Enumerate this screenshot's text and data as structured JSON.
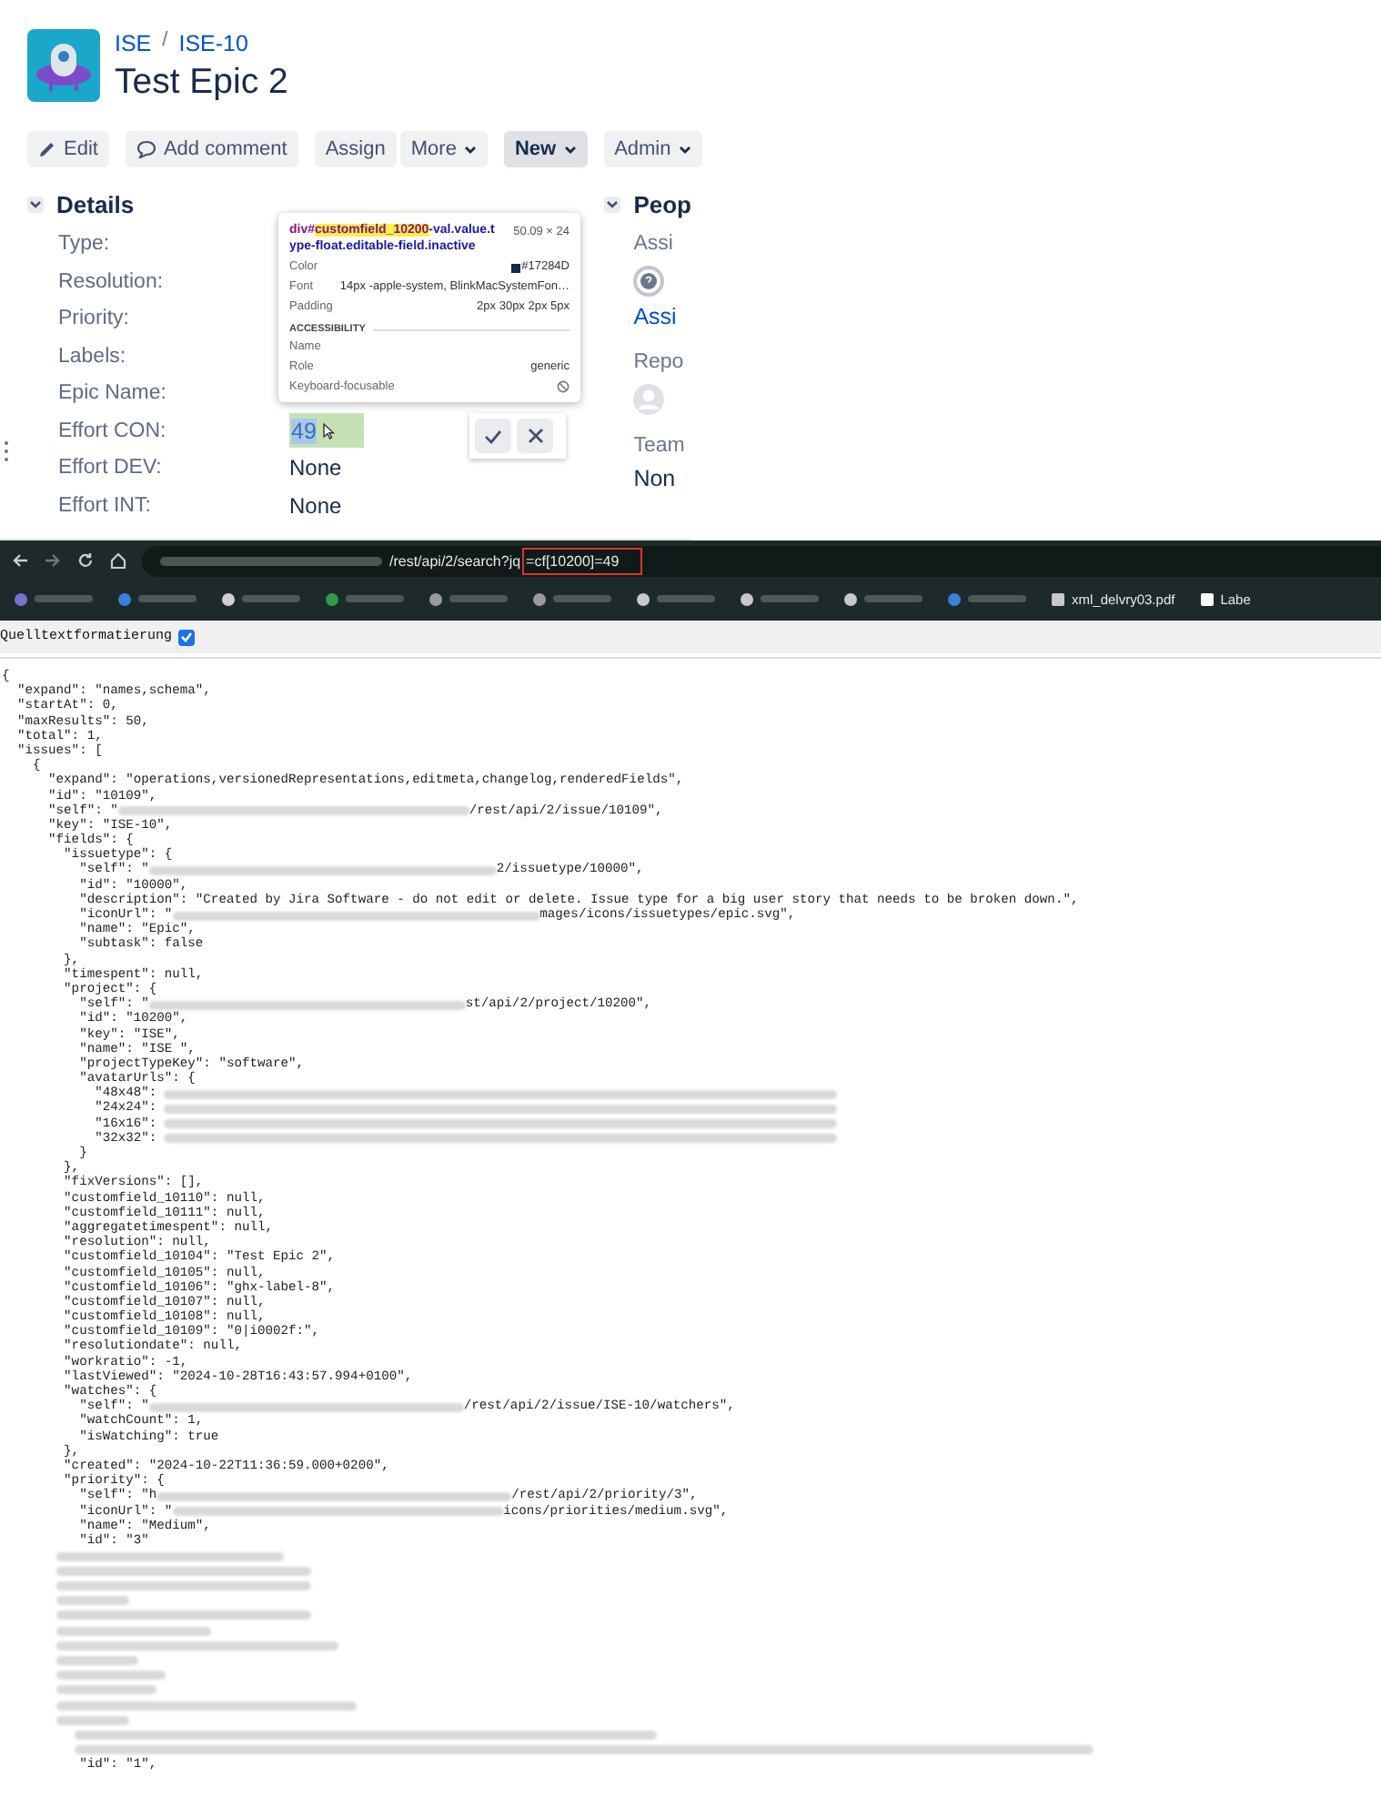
{
  "jira": {
    "breadcrumbs": [
      "ISE",
      "ISE-10"
    ],
    "breadcrumb_separator": "/",
    "title": "Test Epic 2",
    "toolbar": [
      [
        {
          "label": "Edit",
          "kind": "edit",
          "primary": false
        }
      ],
      [
        {
          "label": "Add comment",
          "kind": "comment",
          "primary": false
        }
      ],
      [
        {
          "label": "Assign",
          "kind": "plain",
          "primary": false
        },
        {
          "label": "More",
          "kind": "menu",
          "primary": false
        }
      ],
      [
        {
          "label": "New",
          "kind": "menu",
          "primary": true
        }
      ],
      [
        {
          "label": "Admin",
          "kind": "menu",
          "primary": false
        }
      ]
    ],
    "details": {
      "heading": "Details",
      "fields": [
        {
          "label": "Type:"
        },
        {
          "label": "Resolution:"
        },
        {
          "label": "Priority:"
        },
        {
          "label": "Labels:"
        },
        {
          "label": "Epic Name:"
        },
        {
          "label": "Effort CON:",
          "value": "49",
          "kind": "selected"
        },
        {
          "label": "Effort DEV:",
          "value": "None",
          "kind": "plain"
        },
        {
          "label": "Effort INT:",
          "value": "None",
          "kind": "plain"
        }
      ]
    },
    "people": {
      "heading": "Peop",
      "assignee_label": "Assi",
      "assign_link": "Assi",
      "reporter_label": "Repo",
      "team_label": "Team",
      "team_value": "Non"
    },
    "inspector": {
      "selector_tag": "div#",
      "selector_id": "customfield_10200",
      "selector_rest": "-val.value.type-float.editable-field.inactive",
      "size": "50.09 × 24",
      "rows": [
        {
          "label": "Color",
          "value": "#17284D",
          "color": "#17284d"
        },
        {
          "label": "Font",
          "value": "14px -apple-system, BlinkMacSystemFon…"
        },
        {
          "label": "Padding",
          "value": "2px 30px 2px 5px"
        }
      ],
      "section": "ACCESSIBILITY",
      "a11y_rows": [
        {
          "label": "Name",
          "kind": "text"
        },
        {
          "label": "Role",
          "kind": "text",
          "value": "generic"
        },
        {
          "label": "Keyboard-focusable",
          "kind": "blocked"
        }
      ]
    }
  },
  "browser": {
    "url_path": "/rest/api/2/search?jq",
    "url_highlight": "=cf[10200]=49",
    "bookmarks": [
      {
        "kind": "blurred",
        "color": "#7b6fd0"
      },
      {
        "kind": "blurred",
        "color": "#3b7fd9"
      },
      {
        "kind": "blurred",
        "color": "#d0d0d0"
      },
      {
        "kind": "blurred",
        "color": "#2e9a4a"
      },
      {
        "kind": "blurred",
        "color": "#9a9a9a"
      },
      {
        "kind": "blurred",
        "color": "#9a9a9a"
      },
      {
        "kind": "blurred",
        "color": "#c8c8c8"
      },
      {
        "kind": "blurred",
        "color": "#c8c8c8"
      },
      {
        "kind": "blurred",
        "color": "#c8c8c8"
      },
      {
        "kind": "blurred",
        "color": "#3b7fd9"
      },
      {
        "kind": "file",
        "color": "#c8c8c8",
        "label": "xml_delvry03.pdf"
      },
      {
        "kind": "file",
        "color": "#ffffff",
        "label": "Labe"
      }
    ]
  },
  "source_toggle": {
    "label": "Quelltextformatierung",
    "checked": true
  },
  "code_lines": [
    {
      "kind": "plain",
      "text": "{"
    },
    {
      "kind": "plain",
      "text": "  \"expand\": \"names,schema\","
    },
    {
      "kind": "plain",
      "text": "  \"startAt\": 0,"
    },
    {
      "kind": "plain",
      "text": "  \"maxResults\": 50,"
    },
    {
      "kind": "plain",
      "text": "  \"total\": 1,"
    },
    {
      "kind": "plain",
      "text": "  \"issues\": ["
    },
    {
      "kind": "plain",
      "text": "    {"
    },
    {
      "kind": "plain",
      "text": "      \"expand\": \"operations,versionedRepresentations,editmeta,changelog,renderedFields\","
    },
    {
      "kind": "plain",
      "text": "      \"id\": \"10109\","
    },
    {
      "kind": "redacted",
      "prefix": "      \"self\": \"",
      "suffix": "/rest/api/2/issue/10109\","
    },
    {
      "kind": "plain",
      "text": "      \"key\": \"ISE-10\","
    },
    {
      "kind": "plain",
      "text": "      \"fields\": {"
    },
    {
      "kind": "plain",
      "text": "        \"issuetype\": {"
    },
    {
      "kind": "redacted",
      "prefix": "          \"self\": \"",
      "suffix": "2/issuetype/10000\","
    },
    {
      "kind": "plain",
      "text": "          \"id\": \"10000\","
    },
    {
      "kind": "plain",
      "text": "          \"description\": \"Created by Jira Software - do not edit or delete. Issue type for a big user story that needs to be broken down.\","
    },
    {
      "kind": "redacted",
      "prefix": "          \"iconUrl\": \"",
      "suffix": "mages/icons/issuetypes/epic.svg\","
    },
    {
      "kind": "plain",
      "text": "          \"name\": \"Epic\","
    },
    {
      "kind": "plain",
      "text": "          \"subtask\": false"
    },
    {
      "kind": "plain",
      "text": "        },"
    },
    {
      "kind": "plain",
      "text": "        \"timespent\": null,"
    },
    {
      "kind": "plain",
      "text": "        \"project\": {"
    },
    {
      "kind": "redacted",
      "prefix": "          \"self\": \"",
      "suffix": "st/api/2/project/10200\","
    },
    {
      "kind": "plain",
      "text": "          \"id\": \"10200\","
    },
    {
      "kind": "plain",
      "text": "          \"key\": \"ISE\","
    },
    {
      "kind": "plain",
      "text": "          \"name\": \"ISE \","
    },
    {
      "kind": "plain",
      "text": "          \"projectTypeKey\": \"software\","
    },
    {
      "kind": "plain",
      "text": "          \"avatarUrls\": {"
    },
    {
      "kind": "redacted_long",
      "prefix": "            \"48x48\": "
    },
    {
      "kind": "redacted_long",
      "prefix": "            \"24x24\": "
    },
    {
      "kind": "redacted_long",
      "prefix": "            \"16x16\": "
    },
    {
      "kind": "redacted_long",
      "prefix": "            \"32x32\": "
    },
    {
      "kind": "plain",
      "text": "          }"
    },
    {
      "kind": "plain",
      "text": "        },"
    },
    {
      "kind": "plain",
      "text": "        \"fixVersions\": [],"
    },
    {
      "kind": "plain",
      "text": "        \"customfield_10110\": null,"
    },
    {
      "kind": "plain",
      "text": "        \"customfield_10111\": null,"
    },
    {
      "kind": "plain",
      "text": "        \"aggregatetimespent\": null,"
    },
    {
      "kind": "plain",
      "text": "        \"resolution\": null,"
    },
    {
      "kind": "plain",
      "text": "        \"customfield_10104\": \"Test Epic 2\","
    },
    {
      "kind": "plain",
      "text": "        \"customfield_10105\": null,"
    },
    {
      "kind": "plain",
      "text": "        \"customfield_10106\": \"ghx-label-8\","
    },
    {
      "kind": "plain",
      "text": "        \"customfield_10107\": null,"
    },
    {
      "kind": "plain",
      "text": "        \"customfield_10108\": null,"
    },
    {
      "kind": "plain",
      "text": "        \"customfield_10109\": \"0|i0002f:\","
    },
    {
      "kind": "plain",
      "text": "        \"resolutiondate\": null,"
    },
    {
      "kind": "plain",
      "text": "        \"workratio\": -1,"
    },
    {
      "kind": "plain",
      "text": "        \"lastViewed\": \"2024-10-28T16:43:57.994+0100\","
    },
    {
      "kind": "plain",
      "text": "        \"watches\": {"
    },
    {
      "kind": "redacted",
      "prefix": "          \"self\": \"",
      "suffix": "/rest/api/2/issue/ISE-10/watchers\","
    },
    {
      "kind": "plain",
      "text": "          \"watchCount\": 1,"
    },
    {
      "kind": "plain",
      "text": "          \"isWatching\": true"
    },
    {
      "kind": "plain",
      "text": "        },"
    },
    {
      "kind": "plain",
      "text": "        \"created\": \"2024-10-22T11:36:59.000+0200\","
    },
    {
      "kind": "plain",
      "text": "        \"priority\": {"
    },
    {
      "kind": "redacted",
      "prefix": "          \"self\": \"h",
      "suffix": "/rest/api/2/priority/3\","
    },
    {
      "kind": "redacted",
      "prefix": "          \"iconUrl\": \"",
      "suffix": "icons/priorities/medium.svg\","
    },
    {
      "kind": "plain",
      "text": "          \"name\": \"Medium\","
    },
    {
      "kind": "plain",
      "text": "          \"id\": \"3\""
    },
    {
      "kind": "blurred"
    },
    {
      "kind": "blurred"
    },
    {
      "kind": "blurred"
    },
    {
      "kind": "blurred"
    },
    {
      "kind": "blurred"
    },
    {
      "kind": "blurred"
    },
    {
      "kind": "blurred"
    },
    {
      "kind": "blurred"
    },
    {
      "kind": "blurred"
    },
    {
      "kind": "blurred"
    },
    {
      "kind": "blurred"
    },
    {
      "kind": "blurred"
    },
    {
      "kind": "blurred"
    },
    {
      "kind": "blurred"
    },
    {
      "kind": "plain",
      "text": "          \"id\": \"1\","
    }
  ]
}
